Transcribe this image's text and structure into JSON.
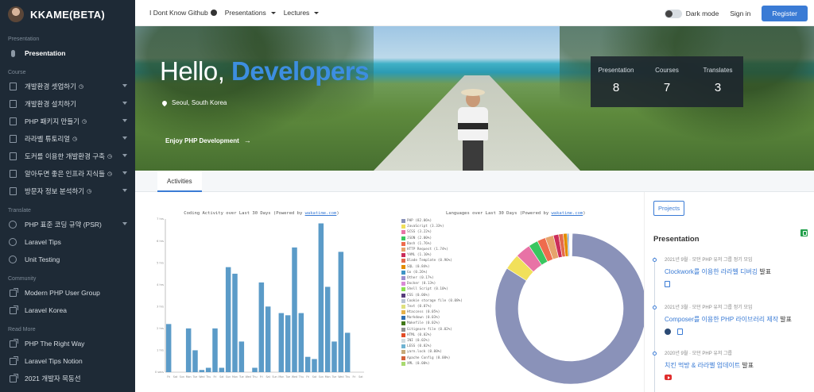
{
  "sidebar": {
    "brand": "KKAME(BETA)",
    "sections": [
      {
        "title": "Presentation",
        "items": [
          {
            "label": "Presentation",
            "icon": "microphone-icon",
            "active": true
          }
        ]
      },
      {
        "title": "Course",
        "items": [
          {
            "label": "개발환경 셋업하기",
            "icon": "book-icon",
            "clock": true,
            "caret": true
          },
          {
            "label": "개발환경 설치하기",
            "icon": "book-icon",
            "clock": false,
            "caret": true
          },
          {
            "label": "PHP 패키지 만들기",
            "icon": "book-icon",
            "clock": true,
            "caret": true
          },
          {
            "label": "라라벨 튜토리얼",
            "icon": "book-icon",
            "clock": true,
            "caret": true
          },
          {
            "label": "도커를 이용한 개발환경 구축",
            "icon": "book-icon",
            "clock": true,
            "caret": true
          },
          {
            "label": "알아두면 좋은 인프라 지식들",
            "icon": "book-icon",
            "clock": true,
            "caret": true
          },
          {
            "label": "방문자 정보 분석하기",
            "icon": "book-icon",
            "clock": true,
            "caret": true
          }
        ]
      },
      {
        "title": "Translate",
        "items": [
          {
            "label": "PHP 표준 코딩 규약 (PSR)",
            "icon": "globe-icon",
            "caret": true
          },
          {
            "label": "Laravel Tips",
            "icon": "globe-icon"
          },
          {
            "label": "Unit Testing",
            "icon": "globe-icon"
          }
        ]
      },
      {
        "title": "Community",
        "items": [
          {
            "label": "Modern PHP User Group",
            "icon": "external-link-icon"
          },
          {
            "label": "Laravel Korea",
            "icon": "external-link-icon"
          }
        ]
      },
      {
        "title": "Read More",
        "items": [
          {
            "label": "PHP The Right Way",
            "icon": "external-link-icon"
          },
          {
            "label": "Laravel Tips Notion",
            "icon": "external-link-icon"
          },
          {
            "label": "2021 개발자 목동선",
            "icon": "external-link-icon"
          }
        ]
      }
    ]
  },
  "topbar": {
    "links": [
      {
        "label": "I Dont Know Github",
        "github": true
      },
      {
        "label": "Presentations",
        "dropdown": true
      },
      {
        "label": "Lectures",
        "dropdown": true
      }
    ],
    "dark_mode": "Dark mode",
    "signin": "Sign in",
    "register": "Register"
  },
  "hero": {
    "hello": "Hello,",
    "highlight": "Developers",
    "location": "Seoul, South Korea",
    "cta": "Enjoy PHP Development",
    "stats": [
      {
        "label": "Presentation",
        "value": "8"
      },
      {
        "label": "Courses",
        "value": "7"
      },
      {
        "label": "Translates",
        "value": "3"
      }
    ]
  },
  "tabs": {
    "activities": "Activities"
  },
  "coding_chart": {
    "title_prefix": "Coding Activity over Last 30 Days (Powered by ",
    "title_link": "wakatime.com",
    "title_suffix": ")"
  },
  "lang_chart": {
    "title_prefix": "Languages over Last 30 Days (Powered by ",
    "title_link": "wakatime.com",
    "title_suffix": ")"
  },
  "chart_data": [
    {
      "type": "bar",
      "title": "Coding Activity over Last 30 Days (Powered by wakatime.com)",
      "categories": [
        "Fri",
        "Sat",
        "Sun",
        "Mon",
        "Tue",
        "Wed",
        "Thu",
        "Fri",
        "Sat",
        "Sun",
        "Mon",
        "Tue",
        "Wed",
        "Thu",
        "Fri",
        "Sat",
        "Sun",
        "Mon",
        "Tue",
        "Wed",
        "Thu",
        "Fri",
        "Sat",
        "Sun",
        "Mon",
        "Tue",
        "Wed",
        "Thu",
        "Fri",
        "Sat"
      ],
      "values": [
        2.2,
        0,
        0,
        2.0,
        1.0,
        0.1,
        0.2,
        2.0,
        0.2,
        4.8,
        4.5,
        1.4,
        0,
        0.2,
        4.1,
        3.0,
        0,
        2.7,
        2.6,
        5.7,
        2.7,
        0.7,
        0.6,
        6.8,
        3.9,
        1.4,
        5.5,
        1.8,
        0,
        0
      ],
      "ylim": [
        0,
        7
      ],
      "y_ticks": [
        "0 secs",
        "1 hrs",
        "2 hrs",
        "3 hrs",
        "4 hrs",
        "5 hrs",
        "6 hrs",
        "7 hrs"
      ],
      "color": "#5b9bc8"
    },
    {
      "type": "pie",
      "title": "Languages over Last 30 Days (Powered by wakatime.com)",
      "legend_position": "left",
      "slices": [
        {
          "label": "PHP (82.06%)",
          "value": 82.06,
          "color": "#8a92b9"
        },
        {
          "label": "JavaScript (3.33%)",
          "value": 3.33,
          "color": "#f1e05a"
        },
        {
          "label": "SCSS (3.22%)",
          "value": 3.22,
          "color": "#e873a6"
        },
        {
          "label": "JSON (2.00%)",
          "value": 2.0,
          "color": "#3ac660"
        },
        {
          "label": "Bash (1.76%)",
          "value": 1.76,
          "color": "#ee6c4d"
        },
        {
          "label": "HTTP Request (1.74%)",
          "value": 1.74,
          "color": "#e6a36c"
        },
        {
          "label": "YAML (1.10%)",
          "value": 1.1,
          "color": "#cb2d5a"
        },
        {
          "label": "Blade Template (0.96%)",
          "value": 0.96,
          "color": "#e46a4c"
        },
        {
          "label": "SQL (0.84%)",
          "value": 0.84,
          "color": "#e38c00"
        },
        {
          "label": "Go (0.26%)",
          "value": 0.26,
          "color": "#3f95c6"
        },
        {
          "label": "Other (0.17%)",
          "value": 0.17,
          "color": "#9b8ed0"
        },
        {
          "label": "Docker (0.13%)",
          "value": 0.13,
          "color": "#d98ad6"
        },
        {
          "label": "Shell Script (0.10%)",
          "value": 0.1,
          "color": "#89e051"
        },
        {
          "label": "CSS (0.06%)",
          "value": 0.06,
          "color": "#563d7c"
        },
        {
          "label": "Cookie storage file (0.08%)",
          "value": 0.08,
          "color": "#b9c4d4"
        },
        {
          "label": "Text (0.07%)",
          "value": 0.07,
          "color": "#dfe07e"
        },
        {
          "label": "Htaccess (0.05%)",
          "value": 0.05,
          "color": "#e6b14a"
        },
        {
          "label": "Markdown (0.03%)",
          "value": 0.03,
          "color": "#2f6fb2"
        },
        {
          "label": "Makefile (0.02%)",
          "value": 0.02,
          "color": "#427819"
        },
        {
          "label": "Gitignore file (0.02%)",
          "value": 0.02,
          "color": "#8e8e8e"
        },
        {
          "label": "HTML (0.02%)",
          "value": 0.02,
          "color": "#e34c26"
        },
        {
          "label": "INI (0.02%)",
          "value": 0.02,
          "color": "#d1dbe0"
        },
        {
          "label": "LESS (0.02%)",
          "value": 0.02,
          "color": "#6fb3d2"
        },
        {
          "label": "yarn.lock (0.00%)",
          "value": 0.0,
          "color": "#c7a978"
        },
        {
          "label": "Apache Config (0.00%)",
          "value": 0.0,
          "color": "#d3613a"
        },
        {
          "label": "XML (0.00%)",
          "value": 0.0,
          "color": "#a8d970"
        }
      ]
    }
  ],
  "right_panel": {
    "projects": "Projects",
    "title": "Presentation",
    "items": [
      {
        "meta": "2021년 9월 · 모던 PHP 유저 그룹 정기 모임",
        "title_hl": "Clockwork를 이용한 라라벨 디버깅",
        "title_rest": " 발표",
        "icons": [
          "document-icon"
        ]
      },
      {
        "meta": "2021년 3월 · 모던 PHP 유저 그룹 정기 모임",
        "title_hl": "Composer를 이용한 PHP 라이브러리 제작",
        "title_rest": " 발표",
        "icons": [
          "github-icon",
          "document-icon"
        ]
      },
      {
        "meta": "2020년 9월 · 모던 PHP 유저 그룹",
        "title_hl": "치킨 먹방 & 라라벨 업데이트",
        "title_rest": " 발표",
        "icons": [
          "youtube-icon"
        ]
      }
    ]
  }
}
